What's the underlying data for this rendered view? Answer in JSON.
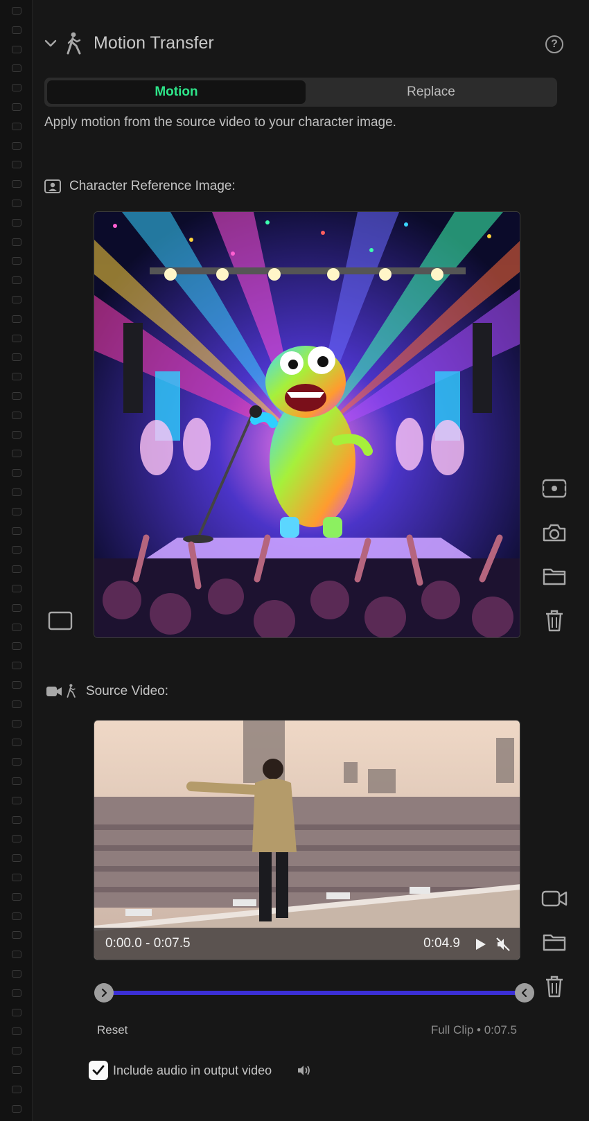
{
  "header": {
    "title": "Motion Transfer",
    "help_label": "?"
  },
  "mode_tabs": [
    {
      "label": "Motion",
      "active": true
    },
    {
      "label": "Replace",
      "active": false
    }
  ],
  "description": "Apply motion from the source video to your character image.",
  "character_section": {
    "label": "Character Reference Image:",
    "image_description": "Colorful furry green-eyed monster singing into a microphone on a concert stage with light beams and a cheering crowd"
  },
  "source_section": {
    "label": "Source Video:",
    "video": {
      "time_range": "0:00.0 - 0:07.5",
      "current_time": "0:04.9"
    }
  },
  "trim": {
    "reset_label": "Reset",
    "full_clip_label": "Full Clip • 0:07.5",
    "start_fraction": 0.0,
    "end_fraction": 1.0
  },
  "audio_option": {
    "label": "Include audio in output video",
    "checked": true
  },
  "colors": {
    "accent_green": "#2ee68a",
    "trim_track": "#3b2fd6",
    "background": "#171717"
  }
}
